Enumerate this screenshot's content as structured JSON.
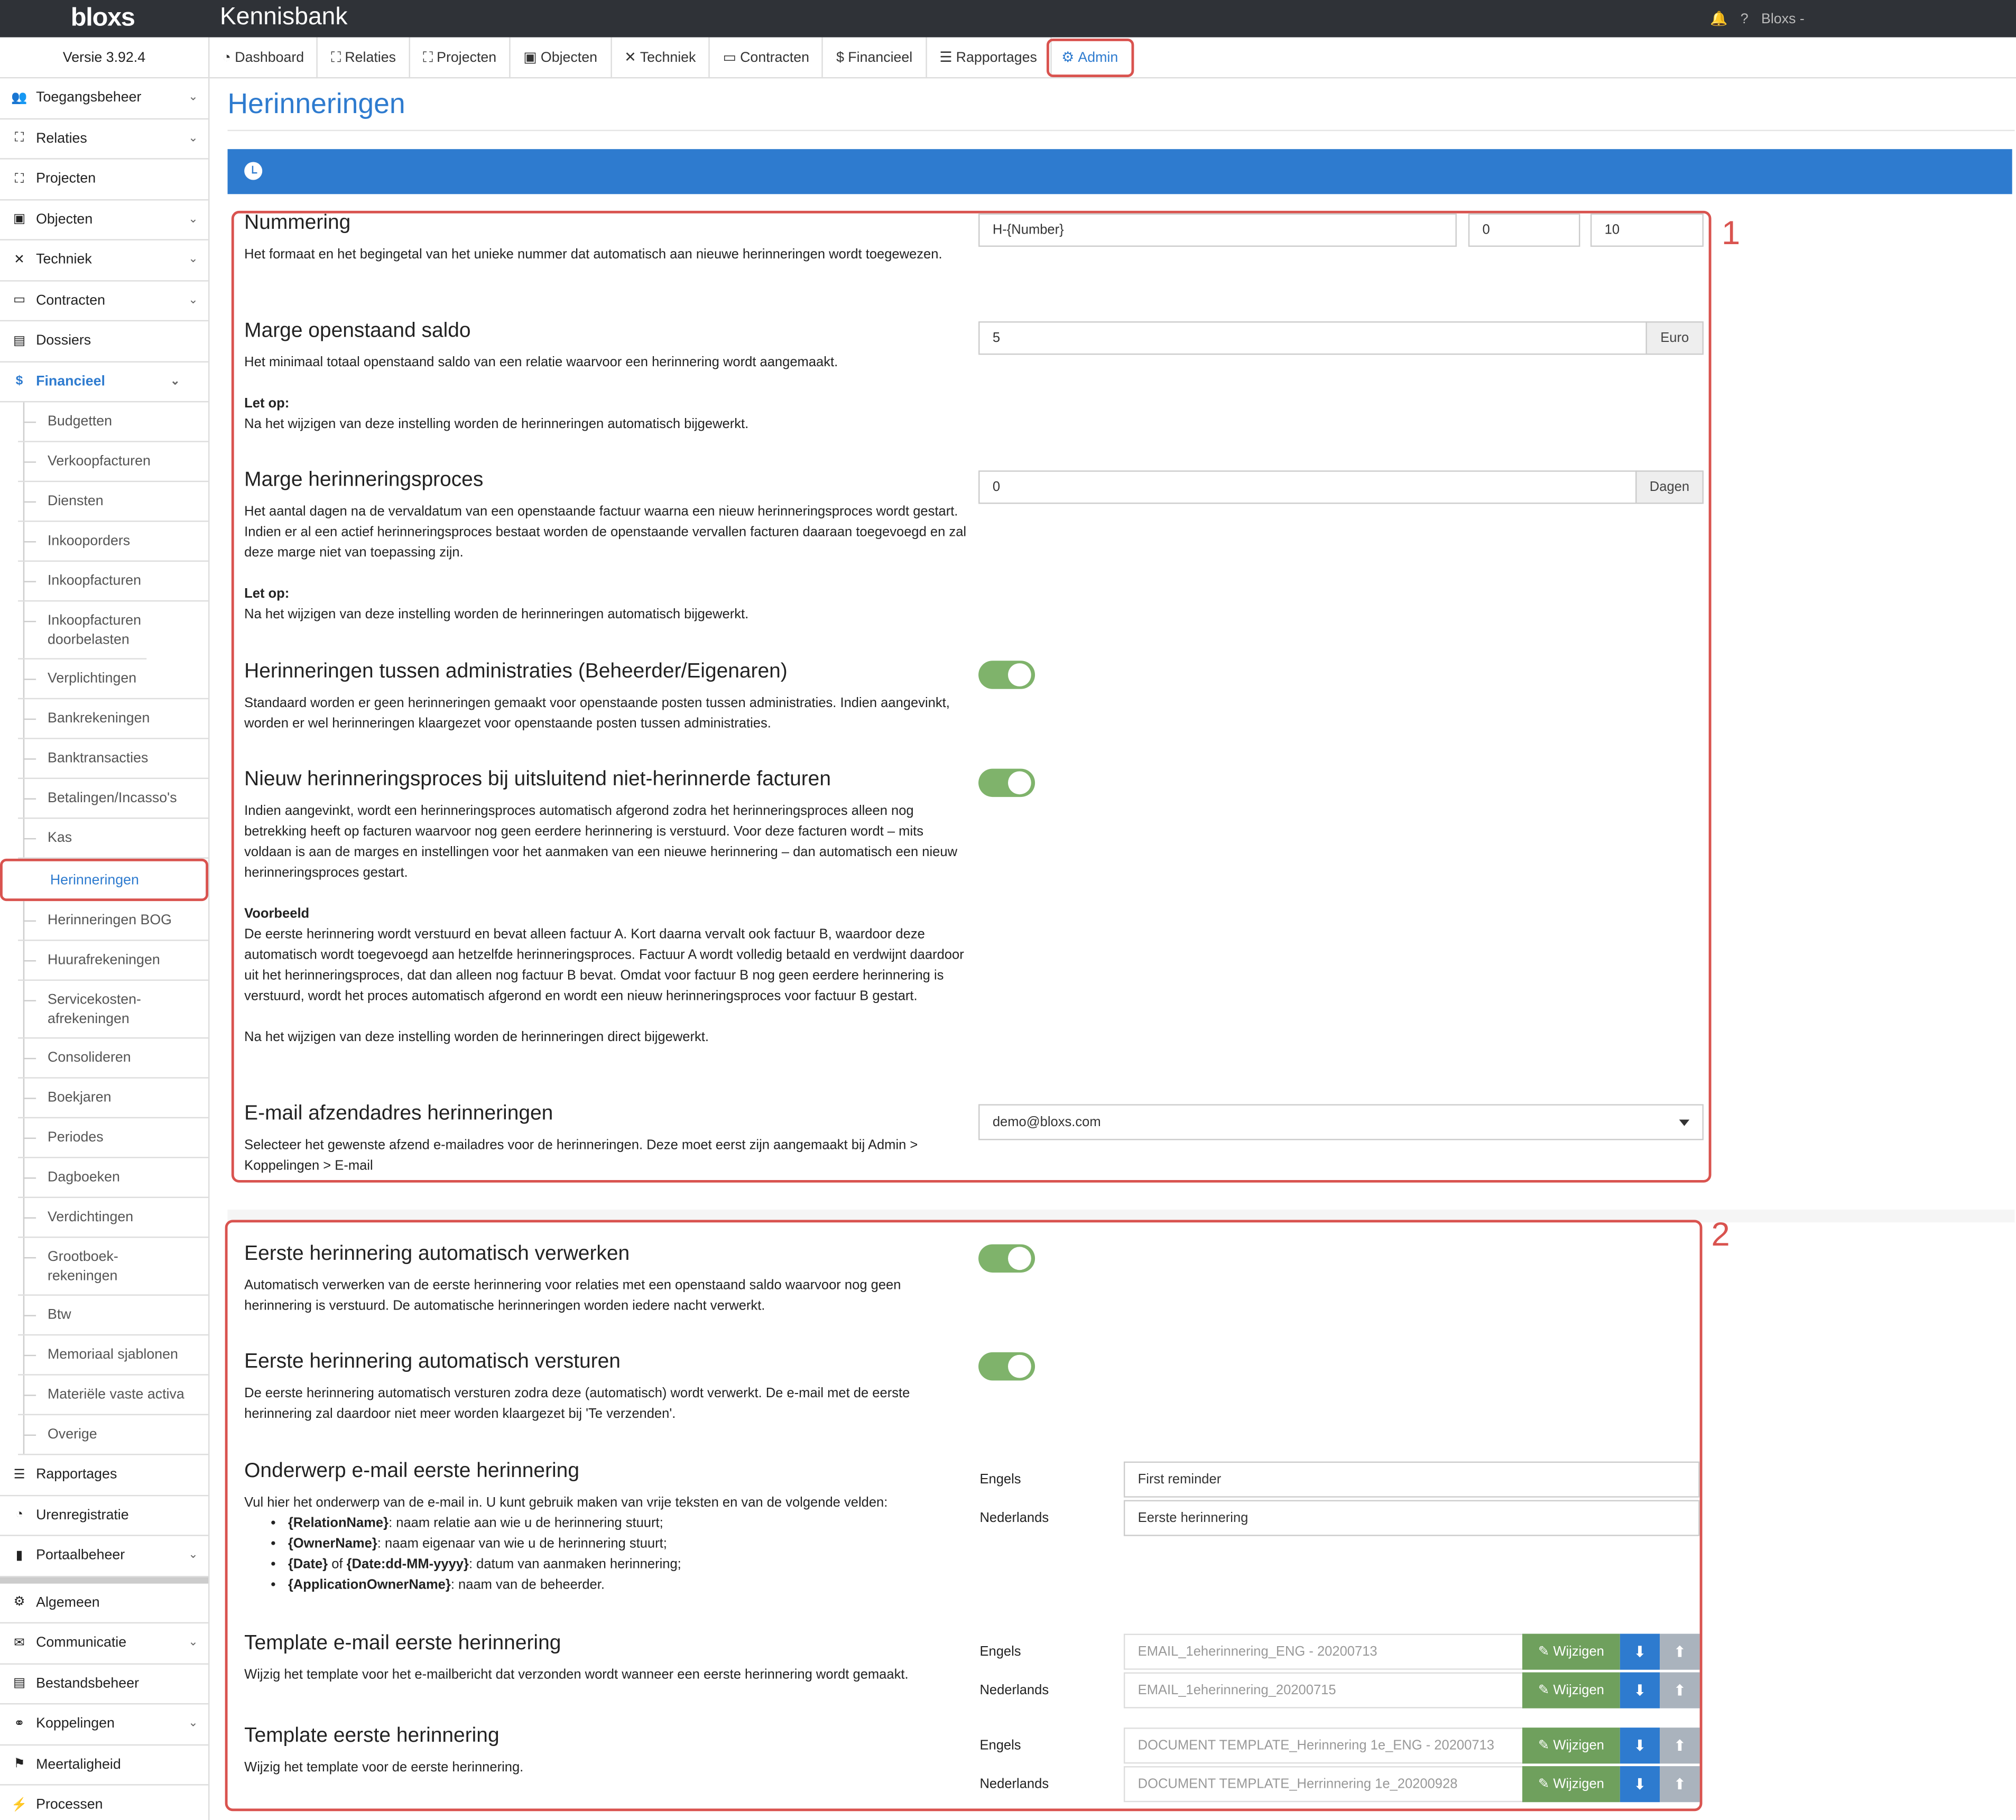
{
  "topbar": {
    "logo": "bloxs",
    "title": "Kennisbank",
    "bell": "🔔",
    "help": "?",
    "user": "Bloxs -"
  },
  "version": "Versie 3.92.4",
  "nav": [
    {
      "icon": "◔",
      "label": "Dashboard"
    },
    {
      "icon": "⛶",
      "label": "Relaties"
    },
    {
      "icon": "⛶",
      "label": "Projecten"
    },
    {
      "icon": "▣",
      "label": "Objecten"
    },
    {
      "icon": "✕",
      "label": "Techniek"
    },
    {
      "icon": "▭",
      "label": "Contracten"
    },
    {
      "icon": "$",
      "label": "Financieel"
    },
    {
      "icon": "☰",
      "label": "Rapportages"
    },
    {
      "icon": "⚙",
      "label": "Admin"
    }
  ],
  "sidebar": {
    "top": [
      {
        "icon": "👥",
        "label": "Toegangsbeheer",
        "chev": "⌄"
      },
      {
        "icon": "⛶",
        "label": "Relaties",
        "chev": "⌄"
      },
      {
        "icon": "⛶",
        "label": "Projecten",
        "chev": ""
      },
      {
        "icon": "▣",
        "label": "Objecten",
        "chev": "⌄"
      },
      {
        "icon": "✕",
        "label": "Techniek",
        "chev": "⌄"
      },
      {
        "icon": "▭",
        "label": "Contracten",
        "chev": "⌄"
      },
      {
        "icon": "▤",
        "label": "Dossiers",
        "chev": ""
      },
      {
        "icon": "$",
        "label": "Financieel",
        "chev": "⌄"
      }
    ],
    "sub": [
      "Budgetten",
      "Verkoopfacturen",
      "Diensten",
      "Inkooporders",
      "Inkoopfacturen",
      "Inkoopfacturen doorbelasten",
      "Verplichtingen",
      "Bankrekeningen",
      "Banktransacties",
      "Betalingen/Incasso's",
      "Kas",
      "Herinneringen",
      "Herinneringen BOG",
      "Huurafrekeningen",
      "Servicekosten-afrekeningen",
      "Consolideren",
      "Boekjaren",
      "Periodes",
      "Dagboeken",
      "Verdichtingen",
      "Grootboek-rekeningen",
      "Btw",
      "Memoriaal sjablonen",
      "Materiële vaste activa",
      "Overige"
    ],
    "bottom1": [
      {
        "icon": "☰",
        "label": "Rapportages",
        "chev": ""
      },
      {
        "icon": "◔",
        "label": "Urenregistratie",
        "chev": ""
      },
      {
        "icon": "▮",
        "label": "Portaalbeheer",
        "chev": "⌄"
      }
    ],
    "bottom2": [
      {
        "icon": "⚙",
        "label": "Algemeen",
        "chev": ""
      },
      {
        "icon": "✉",
        "label": "Communicatie",
        "chev": "⌄"
      },
      {
        "icon": "▤",
        "label": "Bestandsbeheer",
        "chev": ""
      },
      {
        "icon": "⚭",
        "label": "Koppelingen",
        "chev": "⌄"
      },
      {
        "icon": "⚑",
        "label": "Meertaligheid",
        "chev": ""
      },
      {
        "icon": "⚡",
        "label": "Processen",
        "chev": ""
      }
    ]
  },
  "page": {
    "title": "Herinneringen",
    "box1": "1",
    "box2": "2",
    "nummering": {
      "title": "Nummering",
      "desc": "Het formaat en het begingetal van het unieke nummer dat automatisch aan nieuwe herinneringen wordt toegewezen.",
      "format": "H-{Number}",
      "start": "0",
      "length": "10"
    },
    "marge_saldo": {
      "title": "Marge openstaand saldo",
      "desc": "Het minimaal totaal openstaand saldo van een relatie waarvoor een herinnering wordt aangemaakt.",
      "letop": "Let op:",
      "note": "Na het wijzigen van deze instelling worden de herinneringen automatisch bijgewerkt.",
      "value": "5",
      "unit": "Euro"
    },
    "marge_proces": {
      "title": "Marge herinneringsproces",
      "desc": "Het aantal dagen na de vervaldatum van een openstaande factuur waarna een nieuw herinneringsproces wordt gestart. Indien er al een actief herinneringsproces bestaat worden de openstaande vervallen facturen daaraan toegevoegd en zal deze marge niet van toepassing zijn.",
      "letop": "Let op:",
      "note": "Na het wijzigen van deze instelling worden de herinneringen automatisch bijgewerkt.",
      "value": "0",
      "unit": "Dagen"
    },
    "tussen_admin": {
      "title": "Herinneringen tussen administraties (Beheerder/Eigenaren)",
      "desc": "Standaard worden er geen herinneringen gemaakt voor openstaande posten tussen administraties. Indien aangevinkt, worden er wel herinneringen klaargezet voor openstaande posten tussen administraties."
    },
    "nieuw_proces": {
      "title": "Nieuw herinneringsproces bij uitsluitend niet-herinnerde facturen",
      "desc": "Indien aangevinkt, wordt een herinneringsproces automatisch afgerond zodra het herinneringsproces alleen nog betrekking heeft op facturen waarvoor nog geen eerdere herinnering is verstuurd. Voor deze facturen wordt – mits voldaan is aan de marges en instellingen voor het aanmaken van een nieuwe herinnering – dan automatisch een nieuw herinneringsproces gestart.",
      "voorbeeld": "Voorbeeld",
      "example": "De eerste herinnering wordt verstuurd en bevat alleen factuur A. Kort daarna vervalt ook factuur B, waardoor deze automatisch wordt toegevoegd aan hetzelfde herinneringsproces. Factuur A wordt volledig betaald en verdwijnt daardoor uit het herinneringsproces, dat dan alleen nog factuur B bevat. Omdat voor factuur B nog geen eerdere herinnering is verstuurd, wordt het proces automatisch afgerond en wordt een nieuw herinneringsproces voor factuur B gestart.",
      "note": "Na het wijzigen van deze instelling worden de herinneringen direct bijgewerkt."
    },
    "email_afzender": {
      "title": "E-mail afzendadres herinneringen",
      "desc": "Selecteer het gewenste afzend e-mailadres voor de herinneringen. Deze moet eerst zijn aangemaakt bij Admin > Koppelingen > E-mail",
      "value": "demo@bloxs.com"
    },
    "auto_verwerken": {
      "title": "Eerste herinnering automatisch verwerken",
      "desc": "Automatisch verwerken van de eerste herinnering voor relaties met een openstaand saldo waarvoor nog geen herinnering is verstuurd. De automatische herinneringen worden iedere nacht verwerkt."
    },
    "auto_versturen": {
      "title": "Eerste herinnering automatisch versturen",
      "desc": "De eerste herinnering automatisch versturen zodra deze (automatisch) wordt verwerkt. De e-mail met de eerste herinnering zal daardoor niet meer worden klaargezet bij 'Te verzenden'."
    },
    "onderwerp": {
      "title": "Onderwerp e-mail eerste herinnering",
      "desc": "Vul hier het onderwerp van de e-mail in. U kunt gebruik maken van vrije teksten en van de volgende velden:",
      "fields": [
        {
          "k": "{RelationName}",
          "v": ": naam relatie aan wie u de herinnering stuurt;"
        },
        {
          "k": "{OwnerName}",
          "v": ": naam eigenaar van wie u de herinnering stuurt;"
        },
        {
          "k": "{Date}",
          "mid": " of ",
          "k2": "{Date:dd-MM-yyyy}",
          "v": ": datum van aanmaken herinnering;"
        },
        {
          "k": "{ApplicationOwnerName}",
          "v": ": naam van de beheerder."
        }
      ],
      "lang_en": "Engels",
      "lang_nl": "Nederlands",
      "val_en": "First reminder",
      "val_nl": "Eerste herinnering"
    },
    "tpl_email": {
      "title": "Template e-mail eerste herinnering",
      "desc": "Wijzig het template voor het e-mailbericht dat verzonden wordt wanneer een eerste herinnering wordt gemaakt.",
      "lang_en": "Engels",
      "lang_nl": "Nederlands",
      "val_en": "EMAIL_1eherinnering_ENG - 20200713",
      "val_nl": "EMAIL_1eherinnering_20200715"
    },
    "tpl_doc": {
      "title": "Template eerste herinnering",
      "desc": "Wijzig het template voor de eerste herinnering.",
      "lang_en": "Engels",
      "lang_nl": "Nederlands",
      "val_en": "DOCUMENT TEMPLATE_Herinnering 1e_ENG - 20200713",
      "val_nl": "DOCUMENT TEMPLATE_Herrinnering 1e_20200928"
    },
    "btn_wijzigen": "✎ Wijzigen",
    "btn_download": "⬇",
    "btn_upload": "⬆"
  }
}
